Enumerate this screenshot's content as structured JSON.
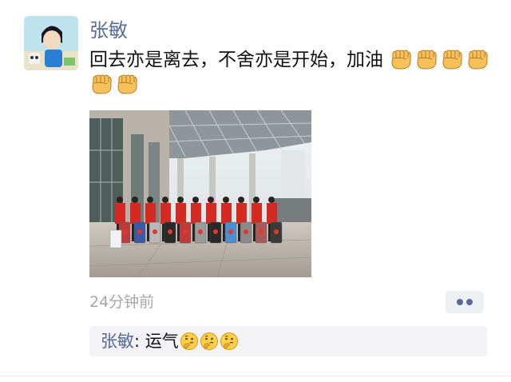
{
  "post": {
    "author": "张敏",
    "text": "回去亦是离去，不舍亦是开始，加油",
    "text_emojis": [
      "fist-emoji",
      "fist-emoji",
      "fist-emoji",
      "fist-emoji",
      "fist-emoji",
      "fist-emoji"
    ],
    "timestamp": "24分钟前"
  },
  "comments": [
    {
      "author": "张敏",
      "separator": ": ",
      "text": "运气",
      "emojis": [
        "thinking-emoji",
        "thinking-emoji",
        "thinking-emoji"
      ]
    }
  ],
  "colors": {
    "link": "#576b95",
    "timestamp": "#a7a7a7",
    "comment_bg": "#f3f3f5",
    "jacket_red": "#d42a22"
  }
}
